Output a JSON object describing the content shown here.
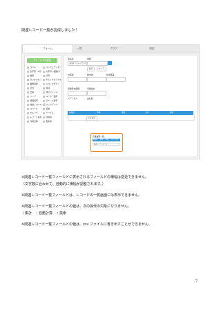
{
  "intro": "関連レコード一覧が完成しました！",
  "screenshot": {
    "tabs": [
      "フォーム",
      "一覧",
      "グラフ",
      "設定"
    ],
    "palette": {
      "add_button": "フィールドを追加",
      "items": [
        "ラベル",
        "リッチエディター",
        "文字列（1行）",
        "文字列（複数行）",
        "数値",
        "計算",
        "ラジオボタン",
        "チェックボックス",
        "複数選択",
        "ドロップダウン",
        "日付",
        "時刻",
        "日時",
        "添付ファイル",
        "リンク",
        "ユーザー選択",
        "組織選択",
        "グループ選択",
        "関連レコード一覧",
        "ルックアップ",
        "スペース",
        "罫線",
        "グループ",
        "テーブル",
        "レコード番号",
        "作成者",
        "作成日時",
        "更新者"
      ]
    },
    "form": {
      "labels": [
        "商品名",
        "単価",
        "お客様",
        "担当者",
        "担当部署",
        "見積有効期限",
        "ステータス",
        "会社名",
        "見積合計"
      ],
      "field_values": [
        "商品A（キャンセル）",
        "",
        "",
        "",
        "",
        ""
      ],
      "lookup_button": "取得",
      "clear_button": "クリア",
      "table_headers": [
        "商品名",
        "単価",
        "数量",
        "小計",
        "備考"
      ],
      "row_button": "行を追加",
      "related": {
        "title": "見積履歴一覧",
        "headers": [
          "商品名",
          "単価",
          "数量",
          "ステータス"
        ],
        "row": "関連レコードの一覧"
      }
    }
  },
  "notes": [
    "※関連レコード一覧フィールドに表示されるフィールドの横幅は変更できません。",
    "（文字数に合わせて、自動的に横幅が調整されます。）",
    "※関連レコード一覧フィールドは、レコードの一覧画面には表示できません。",
    "※関連レコード一覧フィールドの値は、次の操作の対象になりません。",
    "・集計　・自動計算　・検索",
    "※関連レコード一覧フィールドの値は、csv ファイルに書き出すことができません。"
  ],
  "page_number": "7",
  "colors": {
    "accent_blue": "#3498db",
    "palette_green": "#8fd17b",
    "highlight_orange": "#f28c28"
  }
}
